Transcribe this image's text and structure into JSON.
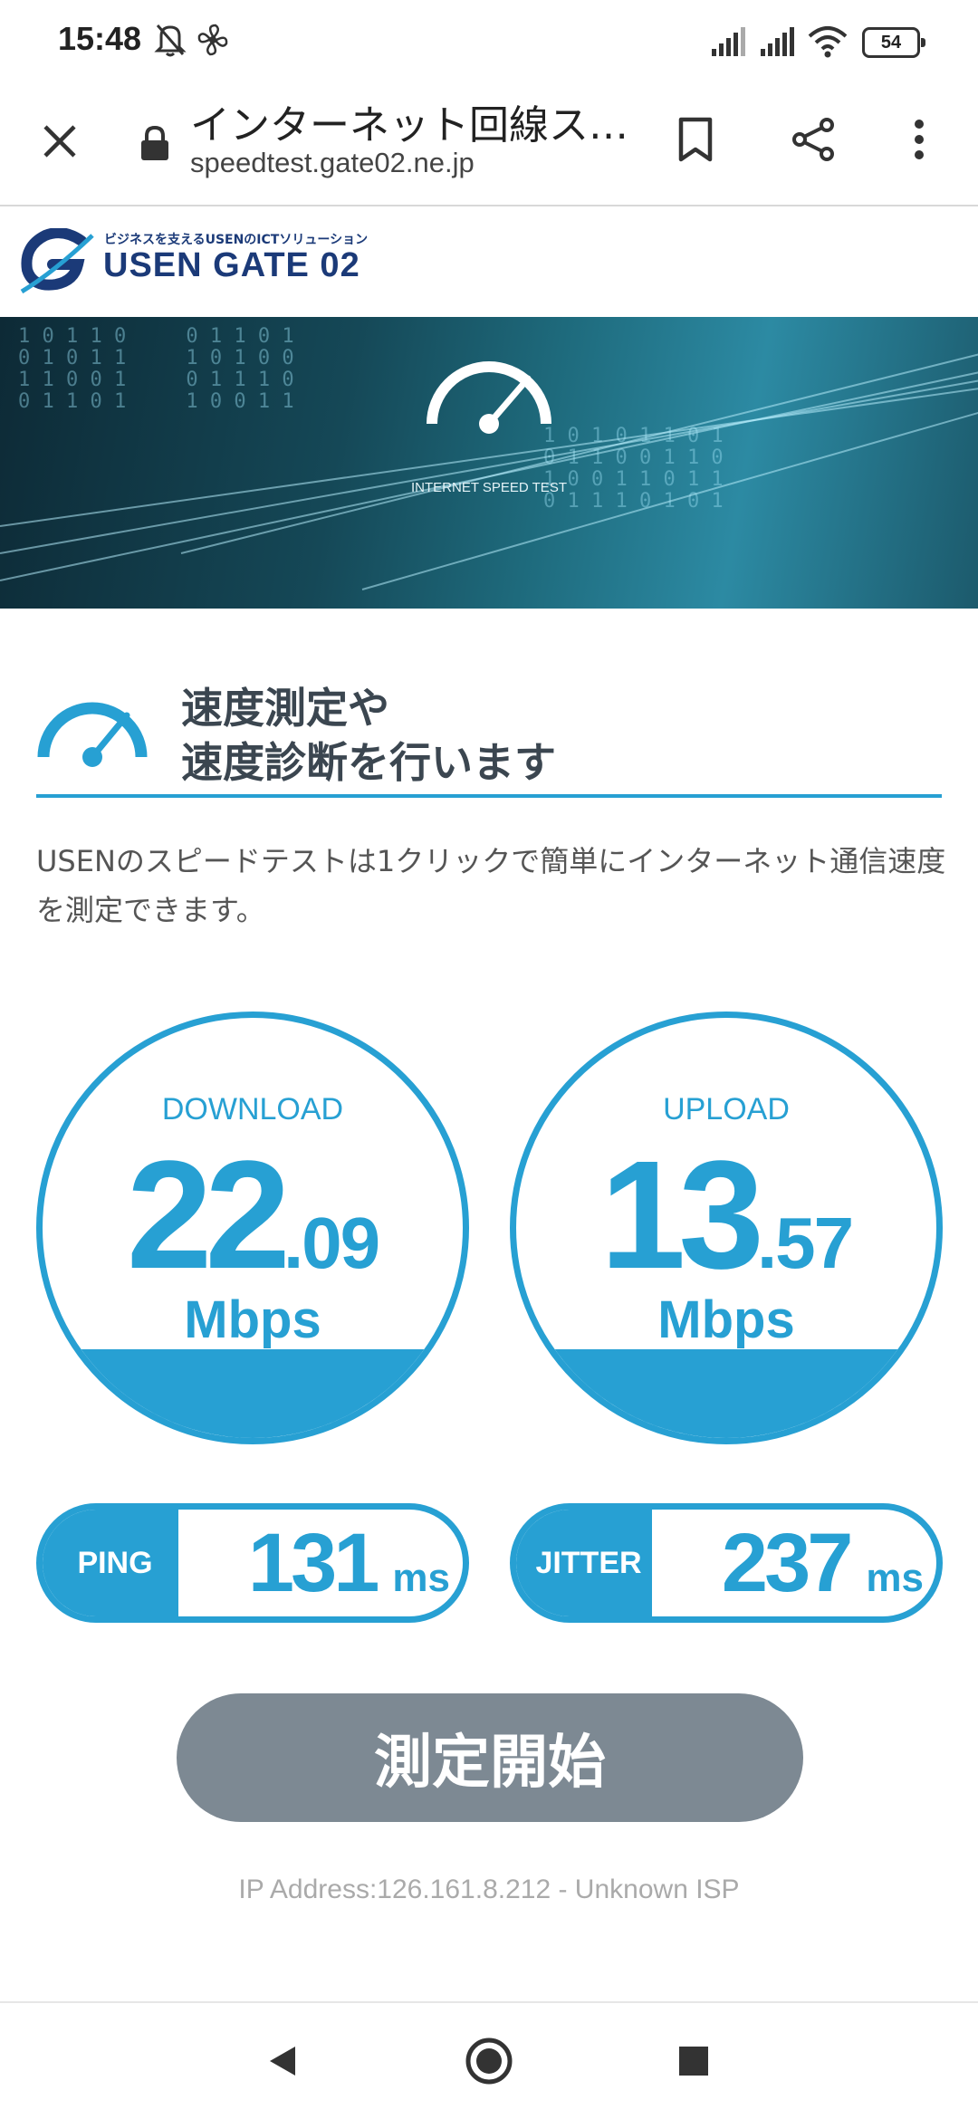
{
  "status_bar": {
    "time": "15:48",
    "battery": "54",
    "icons": [
      "bell-off-icon",
      "fan-icon",
      "signal-icon",
      "signal-icon",
      "wifi-icon",
      "battery-icon"
    ]
  },
  "browser": {
    "page_title": "インターネット回線ス…",
    "url": "speedtest.gate02.ne.jp",
    "icons": [
      "close-icon",
      "lock-icon",
      "bookmark-icon",
      "share-icon",
      "more-vert-icon"
    ]
  },
  "site": {
    "logo_tagline": "ビジネスを支えるUSENのICTソリューション",
    "logo_name": "USEN GATE 02"
  },
  "hero": {
    "caption": "INTERNET SPEED TEST"
  },
  "intro": {
    "heading_line1": "速度測定や",
    "heading_line2": "速度診断を行います",
    "description": "USENのスピードテストは1クリックで簡単にインターネット通信速度を測定できます。"
  },
  "download": {
    "label": "DOWNLOAD",
    "value_int": "22",
    "value_dec": ".09",
    "unit": "Mbps"
  },
  "upload": {
    "label": "UPLOAD",
    "value_int": "13",
    "value_dec": ".57",
    "unit": "Mbps"
  },
  "ping": {
    "label": "PING",
    "value": "131",
    "unit": "ms"
  },
  "jitter": {
    "label": "JITTER",
    "value": "237",
    "unit": "ms"
  },
  "actions": {
    "start_label": "測定開始"
  },
  "footer": {
    "ip_line": "IP Address:126.161.8.212 - Unknown ISP"
  },
  "colors": {
    "accent": "#27a0d3",
    "button_gray": "#7d8993",
    "heading_text": "#3b4650",
    "logo_navy": "#1b3a78"
  }
}
